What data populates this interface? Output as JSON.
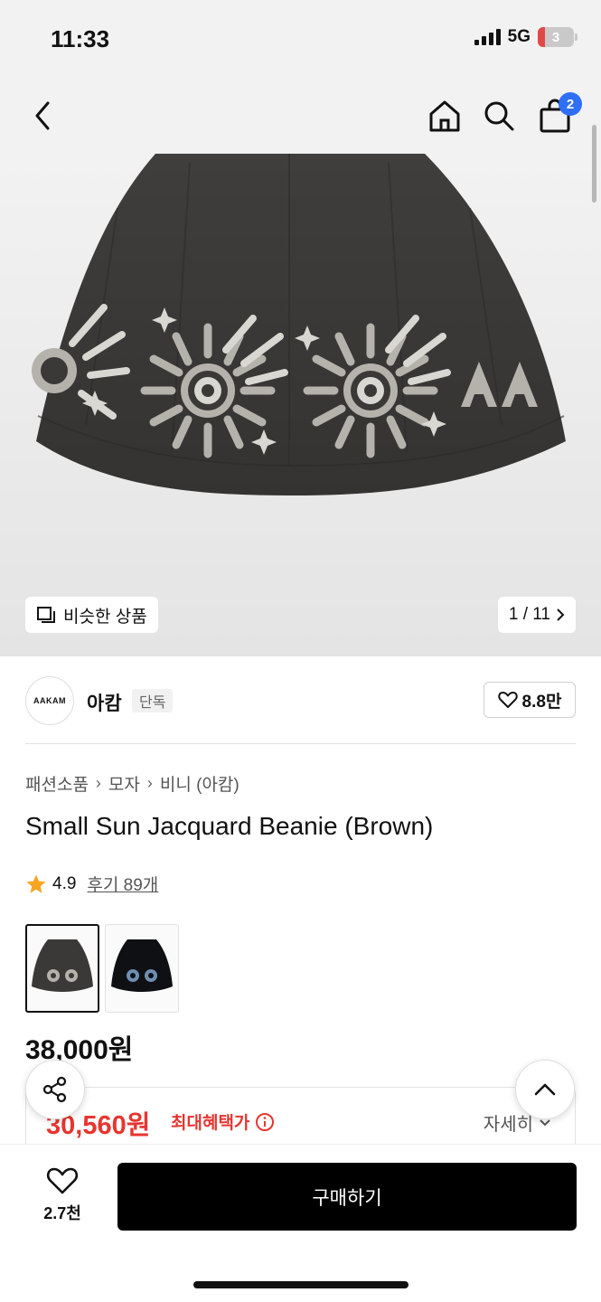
{
  "status": {
    "time": "11:33",
    "network": "5G",
    "battery": "3"
  },
  "header": {
    "cart_count": "2"
  },
  "gallery": {
    "similar_label": "비슷한 상품",
    "pager": "1 / 11"
  },
  "brand": {
    "logo_text": "AAKAM",
    "name": "아캄",
    "tag": "단독",
    "likes": "8.8만"
  },
  "breadcrumb": [
    "패션소품",
    "모자",
    "비니 (아캄)"
  ],
  "product": {
    "title": "Small Sun Jacquard Beanie (Brown)",
    "rating": "4.9",
    "reviews": "후기 89개",
    "price": "38,000원"
  },
  "benefit": {
    "sale_price": "30,560원",
    "label": "최대혜택가",
    "detail": "자세히"
  },
  "bottom": {
    "wish_count": "2.7천",
    "buy_label": "구매하기"
  },
  "colors": {
    "accent_red": "#e8352f",
    "badge_blue": "#2f6ff5",
    "beanie_brown": "#3a3937"
  },
  "icons": [
    "back-icon",
    "home-icon",
    "search-icon",
    "bag-icon",
    "similar-icon",
    "heart-icon",
    "star-icon",
    "info-icon",
    "chevron-down-icon",
    "share-icon",
    "arrow-up-icon"
  ]
}
